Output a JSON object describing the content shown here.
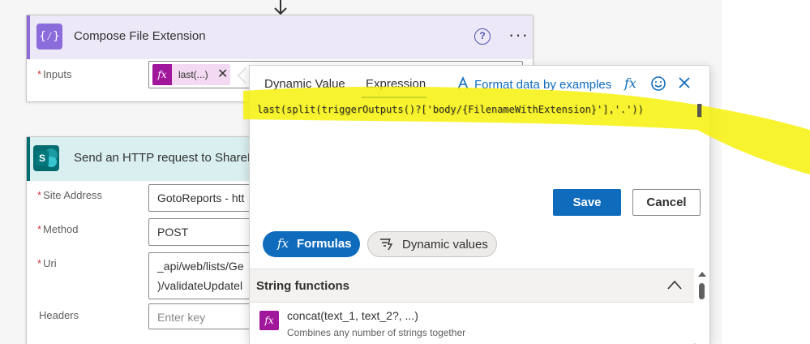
{
  "compose_card": {
    "title": "Compose File Extension",
    "icon_glyph": "{⁄}",
    "help_glyph": "?",
    "more_glyph": "···",
    "inputs_label": "Inputs",
    "token_icon": "fx",
    "token_label": "last(...)",
    "token_close": "✕"
  },
  "sharepoint_card": {
    "title": "Send an HTTP request to SharePoint",
    "icon_letter": "S",
    "fields": [
      {
        "label": "Site Address",
        "value": "GotoReports - htt",
        "required": true
      },
      {
        "label": "Method",
        "value": "POST",
        "required": true
      },
      {
        "label": "Uri",
        "value_line1": "_api/web/lists/Ge",
        "value_line2": ")/validateUpdatel",
        "required": true
      },
      {
        "label": "Headers",
        "placeholder": "Enter key",
        "required": false
      }
    ]
  },
  "popup": {
    "tabs": [
      "Dynamic Value",
      "Expression"
    ],
    "active_tab": "Expression",
    "format_link": "Format data by examples",
    "expression": "last(split(triggerOutputs()?['body/{FilenameWithExtension}'],'.'))",
    "save_label": "Save",
    "cancel_label": "Cancel",
    "pill_formulas_icon": "fx",
    "pill_formulas": "Formulas",
    "pill_dynamic": "Dynamic values",
    "section_title": "String functions",
    "functions": [
      {
        "icon": "fx",
        "name": "concat(text_1, text_2?, ...)",
        "description": "Combines any number of strings together"
      }
    ]
  },
  "colors": {
    "accent": "#0f6cbd",
    "compose_purple": "#8c6cdb",
    "sharepoint_teal": "#036c70",
    "function_magenta": "#a0179c",
    "highlight_yellow": "#f5f000"
  },
  "icons": [
    "down-arrow-icon",
    "compose-icon",
    "help-icon",
    "more-icon",
    "fx-icon",
    "close-icon",
    "sharepoint-icon",
    "format-data-icon",
    "smile-icon",
    "dynamic-values-icon",
    "chevron-up-icon"
  ]
}
